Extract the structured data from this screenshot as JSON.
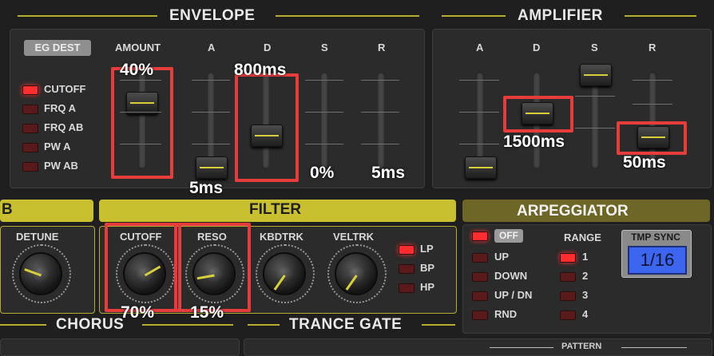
{
  "envelope": {
    "title": "ENVELOPE",
    "eg_dest_button": "EG DEST",
    "dest_options": [
      {
        "label": "CUTOFF",
        "active": true
      },
      {
        "label": "FRQ A",
        "active": false
      },
      {
        "label": "FRQ AB",
        "active": false
      },
      {
        "label": "PW A",
        "active": false
      },
      {
        "label": "PW AB",
        "active": false
      }
    ],
    "col_amount": "AMOUNT",
    "col_a": "A",
    "col_d": "D",
    "col_s": "S",
    "col_r": "R",
    "amount_value": "40%",
    "a_value": "5ms",
    "d_value": "800ms",
    "s_value": "0%",
    "r_value": "5ms"
  },
  "amplifier": {
    "title": "AMPLIFIER",
    "col_a": "A",
    "col_d": "D",
    "col_s": "S",
    "col_r": "R",
    "d_value": "1500ms",
    "r_value": "50ms"
  },
  "osc_b": {
    "title": "B",
    "detune_label": "DETUNE"
  },
  "filter": {
    "title": "FILTER",
    "cutoff_label": "CUTOFF",
    "reso_label": "RESO",
    "kbdtrk_label": "KBDTRK",
    "veltrk_label": "VELTRK",
    "cutoff_value": "70%",
    "reso_value": "15%",
    "types": [
      {
        "label": "LP",
        "active": true
      },
      {
        "label": "BP",
        "active": false
      },
      {
        "label": "HP",
        "active": false
      }
    ]
  },
  "arpeggiator": {
    "title": "ARPEGGIATOR",
    "off_label": "OFF",
    "modes": [
      "UP",
      "DOWN",
      "UP / DN",
      "RND"
    ],
    "range_label": "RANGE",
    "ranges": [
      {
        "label": "1",
        "active": true
      },
      {
        "label": "2",
        "active": false
      },
      {
        "label": "3",
        "active": false
      },
      {
        "label": "4",
        "active": false
      }
    ],
    "tmp_sync_label": "TMP SYNC",
    "tmp_sync_value": "1/16"
  },
  "bottom": {
    "chorus_title": "CHORUS",
    "trance_gate_title": "TRANCE GATE",
    "pattern_label": "PATTERN"
  }
}
